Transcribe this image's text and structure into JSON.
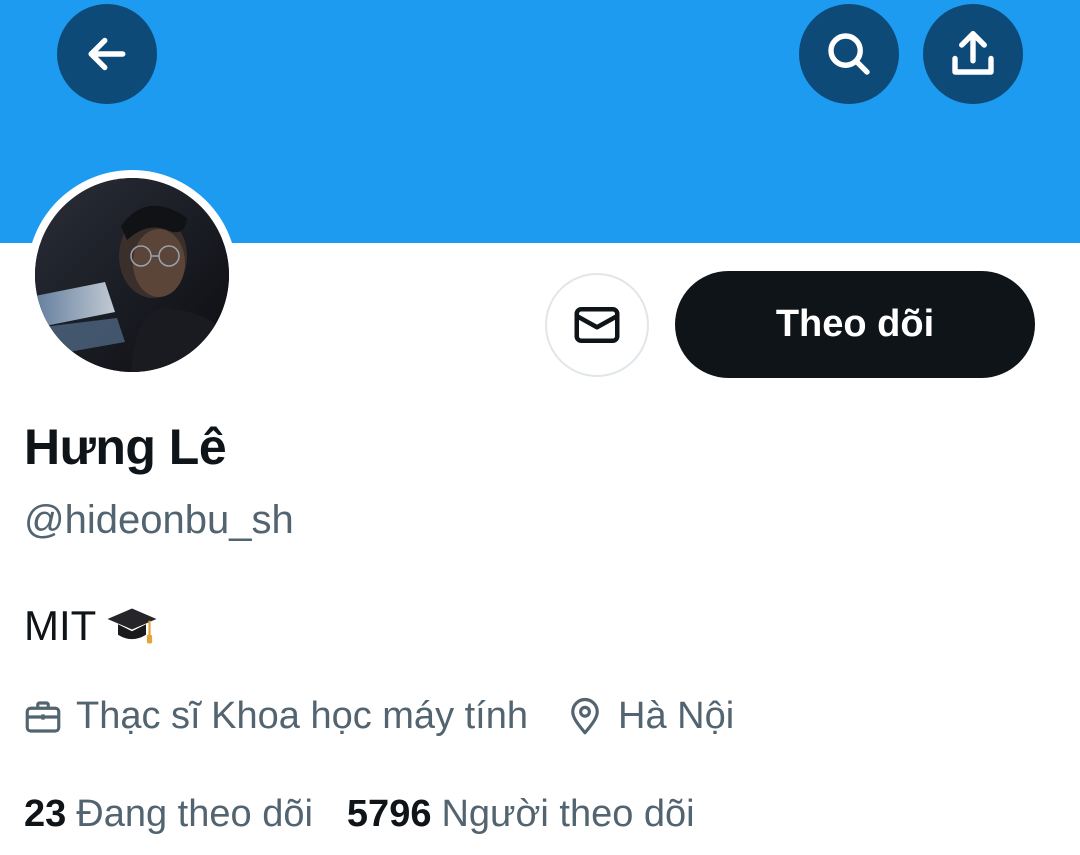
{
  "header": {
    "banner_color": "#1d9bf0",
    "back_icon": "arrow-left-icon",
    "search_icon": "search-icon",
    "share_icon": "share-icon"
  },
  "profile": {
    "name": "Hưng Lê",
    "handle": "@hideonbu_sh",
    "bio": "MIT",
    "bio_emoji": "graduation-cap-icon",
    "occupation": "Thạc sĩ Khoa học máy tính",
    "location": "Hà Nội"
  },
  "actions": {
    "message_icon": "mail-icon",
    "follow_label": "Theo dõi"
  },
  "stats": {
    "following_count": "23",
    "following_label": "Đang theo dõi",
    "followers_count": "5796",
    "followers_label": "Người theo dõi"
  },
  "colors": {
    "accent": "#1d9bf0",
    "primary_text": "#0f1419",
    "secondary_text": "#536471"
  }
}
